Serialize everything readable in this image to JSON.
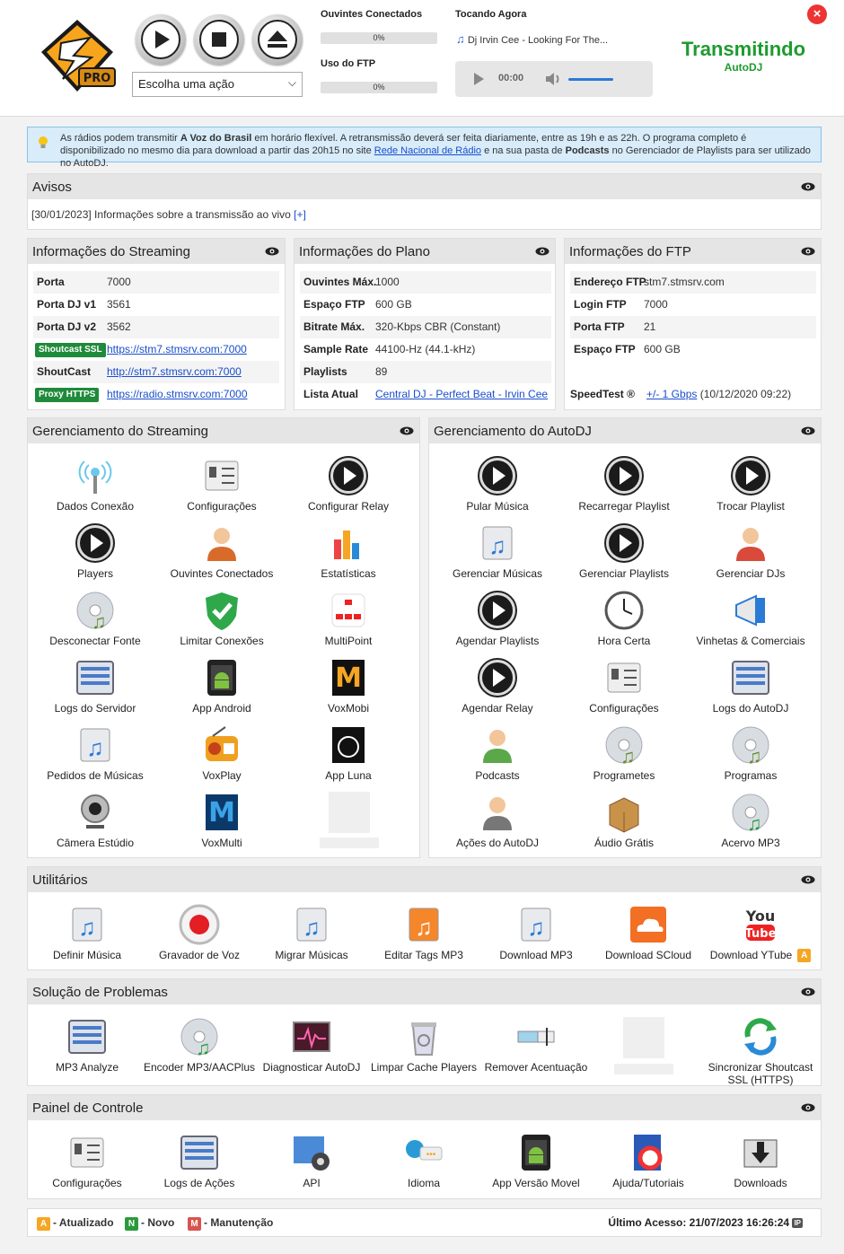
{
  "header": {
    "action_select": "Escolha uma ação",
    "listeners_label": "Ouvintes Conectados",
    "listeners_pct": "0%",
    "ftp_label": "Uso do FTP",
    "ftp_pct": "0%",
    "now_playing_label": "Tocando Agora",
    "now_playing": "Dj Irvin Cee - Looking For The...",
    "player_time": "00:00",
    "status": "Transmitindo",
    "status_sub": "AutoDJ",
    "logo_text": "PRO"
  },
  "notice": {
    "p1": "As rádios podem transmitir ",
    "b1": "A Voz do Brasil",
    "p2": " em horário flexível. A retransmissão deverá ser feita diariamente, entre as 19h e as 22h. O programa completo é disponibilizado no mesmo dia para download a partir das 20h15 no site ",
    "link": "Rede Nacional de Rádio",
    "p3": " e na sua pasta de ",
    "b2": "Podcasts",
    "p4": " no Gerenciador de Playlists para ser utilizado no AutoDJ."
  },
  "avisos": {
    "title": "Avisos",
    "text": "[30/01/2023] Informações sobre a transmissão ao vivo ",
    "link": "[+]"
  },
  "streaming_info": {
    "title": "Informações do Streaming",
    "rows": [
      {
        "k": "Porta",
        "v": "7000"
      },
      {
        "k": "Porta DJ v1",
        "v": "3561"
      },
      {
        "k": "Porta DJ v2",
        "v": "3562"
      },
      {
        "badge": "Shoutcast SSL",
        "v": "https://stm7.stmsrv.com:7000"
      },
      {
        "k": "ShoutCast",
        "v": "http://stm7.stmsrv.com:7000"
      },
      {
        "badge": "Proxy HTTPS",
        "v": "https://radio.stmsrv.com:7000"
      }
    ]
  },
  "plan_info": {
    "title": "Informações do Plano",
    "rows": [
      {
        "k": "Ouvintes Máx.",
        "v": "1000"
      },
      {
        "k": "Espaço FTP",
        "v": "600 GB"
      },
      {
        "k": "Bitrate Máx.",
        "v": "320-Kbps CBR (Constant)"
      },
      {
        "k": "Sample Rate",
        "v": "44100-Hz (44.1-kHz)"
      },
      {
        "k": "Playlists",
        "v": "89"
      },
      {
        "k": "Lista Atual",
        "v": "Central DJ - Perfect Beat - Irvin Cee"
      }
    ]
  },
  "ftp_info": {
    "title": "Informações do FTP",
    "rows": [
      {
        "k": "Endereço FTP",
        "v": "stm7.stmsrv.com"
      },
      {
        "k": "Login FTP",
        "v": "7000"
      },
      {
        "k": "Porta FTP",
        "v": "21"
      },
      {
        "k": "Espaço FTP",
        "v": "600 GB"
      }
    ],
    "speedtest_label": "SpeedTest ®",
    "speedtest_link": "+/- 1 Gbps",
    "speedtest_date": "(10/12/2020 09:22)"
  },
  "streaming_mgmt": {
    "title": "Gerenciamento do Streaming",
    "items": [
      {
        "label": "Dados Conexão",
        "icon": "antenna-icon"
      },
      {
        "label": "Configurações",
        "icon": "settings-sliders-icon"
      },
      {
        "label": "Configurar Relay",
        "icon": "relay-play-icon"
      },
      {
        "label": "Players",
        "icon": "media-player-icon"
      },
      {
        "label": "Ouvintes Conectados",
        "icon": "listeners-group-icon"
      },
      {
        "label": "Estatísticas",
        "icon": "bar-chart-icon"
      },
      {
        "label": "Desconectar Fonte",
        "icon": "disconnect-disc-icon"
      },
      {
        "label": "Limitar Conexões",
        "icon": "shield-check-icon"
      },
      {
        "label": "MultiPoint",
        "icon": "multipoint-icon"
      },
      {
        "label": "Logs do Servidor",
        "icon": "server-logs-icon"
      },
      {
        "label": "App Android",
        "icon": "android-app-icon"
      },
      {
        "label": "VoxMobi",
        "icon": "voxmobi-icon"
      },
      {
        "label": "Pedidos de Músicas",
        "icon": "song-request-icon"
      },
      {
        "label": "VoxPlay",
        "icon": "radio-icon"
      },
      {
        "label": "App Luna",
        "icon": "luna-app-icon"
      },
      {
        "label": "Câmera Estúdio",
        "icon": "webcam-icon"
      },
      {
        "label": "VoxMulti",
        "icon": "voxmulti-icon"
      }
    ]
  },
  "autodj_mgmt": {
    "title": "Gerenciamento do AutoDJ",
    "items": [
      {
        "label": "Pular Música",
        "icon": "skip-track-icon"
      },
      {
        "label": "Recarregar Playlist",
        "icon": "reload-playlist-icon"
      },
      {
        "label": "Trocar Playlist",
        "icon": "swap-playlist-icon"
      },
      {
        "label": "Gerenciar Músicas",
        "icon": "music-folder-icon"
      },
      {
        "label": "Gerenciar Playlists",
        "icon": "playlist-icon"
      },
      {
        "label": "Gerenciar DJs",
        "icon": "dj-headset-icon"
      },
      {
        "label": "Agendar Playlists",
        "icon": "schedule-playlist-icon"
      },
      {
        "label": "Hora Certa",
        "icon": "clock-icon"
      },
      {
        "label": "Vinhetas & Comerciais",
        "icon": "megaphone-icon"
      },
      {
        "label": "Agendar Relay",
        "icon": "schedule-relay-icon"
      },
      {
        "label": "Configurações",
        "icon": "settings-sliders-icon"
      },
      {
        "label": "Logs do AutoDJ",
        "icon": "autodj-logs-icon"
      },
      {
        "label": "Podcasts",
        "icon": "podcast-person-icon"
      },
      {
        "label": "Programetes",
        "icon": "programetes-disc-icon"
      },
      {
        "label": "Programas",
        "icon": "programas-disc-icon"
      },
      {
        "label": "Ações do AutoDJ",
        "icon": "autodj-actions-icon"
      },
      {
        "label": "Áudio Grátis",
        "icon": "free-audio-box-icon"
      },
      {
        "label": "Acervo MP3",
        "icon": "mp3-archive-icon"
      }
    ]
  },
  "utilities": {
    "title": "Utilitários",
    "items": [
      {
        "label": "Definir Música",
        "icon": "set-song-icon"
      },
      {
        "label": "Gravador de Voz",
        "icon": "record-icon"
      },
      {
        "label": "Migrar Músicas",
        "icon": "migrate-music-icon"
      },
      {
        "label": "Editar Tags MP3",
        "icon": "mp3-tag-icon"
      },
      {
        "label": "Download MP3",
        "icon": "download-mp3-icon"
      },
      {
        "label": "Download SCloud",
        "icon": "soundcloud-icon"
      },
      {
        "label": "Download YTube",
        "icon": "youtube-icon",
        "badge": "A"
      }
    ]
  },
  "troubleshoot": {
    "title": "Solução de Problemas",
    "items": [
      {
        "label": "MP3 Analyze",
        "icon": "mp3-analyze-icon"
      },
      {
        "label": "Encoder MP3/AACPlus",
        "icon": "encoder-icon"
      },
      {
        "label": "Diagnosticar AutoDJ",
        "icon": "diagnose-icon"
      },
      {
        "label": "Limpar Cache Players",
        "icon": "trash-icon"
      },
      {
        "label": "Remover Acentuação",
        "icon": "text-cursor-icon"
      },
      {
        "label": "Sincronizar Shoutcast SSL (HTTPS)",
        "icon": "sync-icon"
      }
    ]
  },
  "control_panel": {
    "title": "Painel de Controle",
    "items": [
      {
        "label": "Configurações",
        "icon": "settings-sliders-icon"
      },
      {
        "label": "Logs de Ações",
        "icon": "action-logs-icon"
      },
      {
        "label": "API",
        "icon": "api-gear-icon"
      },
      {
        "label": "Idioma",
        "icon": "language-chat-icon"
      },
      {
        "label": "App Versão Movel",
        "icon": "mobile-app-icon"
      },
      {
        "label": "Ajuda/Tutoriais",
        "icon": "help-book-icon"
      },
      {
        "label": "Downloads",
        "icon": "downloads-icon"
      }
    ]
  },
  "footer": {
    "a_badge": "A",
    "a_label": "- Atualizado",
    "n_badge": "N",
    "n_label": "- Novo",
    "m_badge": "M",
    "m_label": "- Manutenção",
    "last_access": "Último Acesso: 21/07/2023 16:26:24",
    "ip_badge": "IP"
  },
  "colors": {
    "accent_green": "#1e9b2f",
    "badge_green": "#1f8a3a",
    "link_blue": "#1a4dcc",
    "updated_orange": "#f5a623",
    "new_green": "#2a9a3a",
    "maintenance_red": "#d9534f"
  }
}
